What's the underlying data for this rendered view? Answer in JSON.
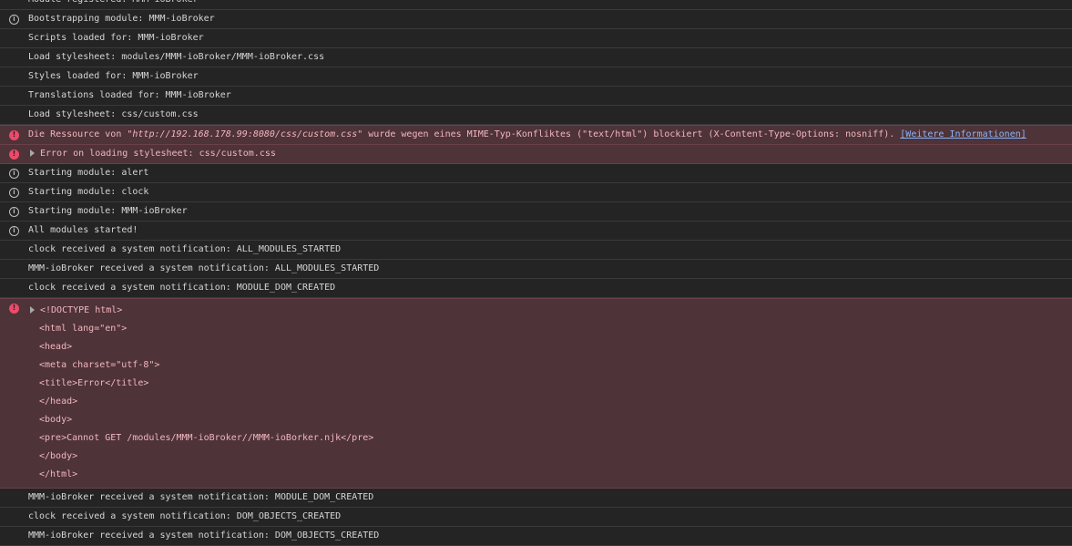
{
  "console": {
    "rows": [
      {
        "level": "none",
        "text": "Module registered: MMM-ioBroker"
      },
      {
        "level": "info",
        "text": "Bootstrapping module: MMM-ioBroker"
      },
      {
        "level": "none",
        "text": "Scripts loaded for: MMM-ioBroker"
      },
      {
        "level": "none",
        "text": "Load stylesheet: modules/MMM-ioBroker/MMM-ioBroker.css"
      },
      {
        "level": "none",
        "text": "Styles loaded for: MMM-ioBroker"
      },
      {
        "level": "none",
        "text": "Translations loaded for: MMM-ioBroker"
      },
      {
        "level": "none",
        "text": "Load stylesheet: css/custom.css"
      },
      {
        "level": "error",
        "text_before": "Die Ressource von ",
        "url": "\"http://192.168.178.99:8080/css/custom.css\"",
        "text_after": " wurde wegen eines MIME-Typ-Konfliktes (\"text/html\") blockiert (X-Content-Type-Options: nosniff). ",
        "link": "[Weitere Informationen]"
      },
      {
        "level": "error",
        "expandable": true,
        "text": "Error on loading stylesheet: css/custom.css"
      },
      {
        "level": "info",
        "text": "Starting module: alert"
      },
      {
        "level": "info",
        "text": "Starting module: clock"
      },
      {
        "level": "info",
        "text": "Starting module: MMM-ioBroker"
      },
      {
        "level": "info",
        "text": "All modules started!"
      },
      {
        "level": "none",
        "text": "clock received a system notification: ALL_MODULES_STARTED"
      },
      {
        "level": "none",
        "text": "MMM-ioBroker received a system notification: ALL_MODULES_STARTED"
      },
      {
        "level": "none",
        "text": "clock received a system notification: MODULE_DOM_CREATED"
      },
      {
        "level": "error",
        "expandable": true,
        "lines": [
          "<!DOCTYPE html>",
          "<html lang=\"en\">",
          "<head>",
          "<meta charset=\"utf-8\">",
          "<title>Error</title>",
          "</head>",
          "<body>",
          "<pre>Cannot GET /modules/MMM-ioBroker//MMM-ioBorker.njk</pre>",
          "</body>",
          "</html>"
        ]
      },
      {
        "level": "none",
        "text": "MMM-ioBroker received a system notification: MODULE_DOM_CREATED"
      },
      {
        "level": "none",
        "text": "clock received a system notification: DOM_OBJECTS_CREATED"
      },
      {
        "level": "none",
        "text": "MMM-ioBroker received a system notification: DOM_OBJECTS_CREATED"
      }
    ]
  },
  "icons": {
    "info": "info-icon",
    "error": "error-icon",
    "expand": "disclosure-triangle-icon"
  },
  "colors": {
    "background": "#242424",
    "error_background": "#4e3338",
    "error_text": "#f2b6bf",
    "error_icon": "#ec4b6a",
    "link": "#8ab4f8"
  }
}
